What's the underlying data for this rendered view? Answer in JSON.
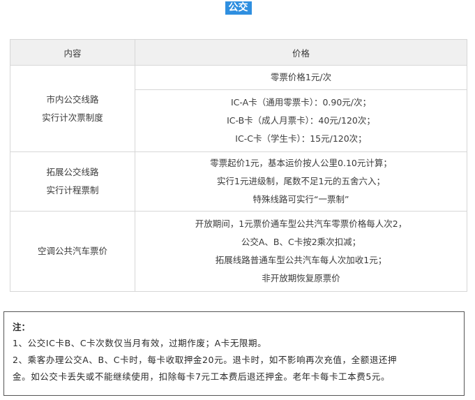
{
  "title": "公交",
  "table": {
    "headers": [
      "内容",
      "价格"
    ],
    "rows": [
      {
        "content": [
          "市内公交线路",
          "实行计次票制度"
        ],
        "price_top": "零票价格1元/次",
        "price_bottom": [
          "IC-A卡（通用零票卡）：0.90元/次；",
          "IC-B卡（成人月票卡）：40元/120次；",
          "IC-C卡（学生卡）：15元/120次；"
        ]
      },
      {
        "content": [
          "拓展公交线路",
          "实行计程票制"
        ],
        "price": [
          "零票起价1元，基本运价按人公里0.10元计算；",
          "实行1元进级制，尾数不足1元的五舍六入；",
          "特殊线路可实行“一票制”"
        ]
      },
      {
        "content": [
          "空调公共汽车票价"
        ],
        "price": [
          "开放期间，1元票价通车型公共汽车零票价格每人次2，",
          "公交A、B、C卡按2乘次扣减；",
          "拓展线路普通车型公共汽车每人次加收1元；",
          "非开放期恢复原票价"
        ]
      }
    ]
  },
  "note": {
    "title": "注：",
    "lines": [
      "1、公交IC卡B、C卡次数仅当月有效，过期作废；A卡无限期。",
      "2、乘客办理公交A、B、C卡时，每卡收取押金20元。退卡时，如不影响再次充值，全额退还押",
      "金。如公交卡丢失或不能继续使用，扣除每卡7元工本费后退还押金。老年卡每卡工本费5元。"
    ]
  },
  "colors": {
    "badge_bg": "#2f8fe0",
    "header_bg": "#f0f0f0",
    "border": "#d6d6d6"
  }
}
